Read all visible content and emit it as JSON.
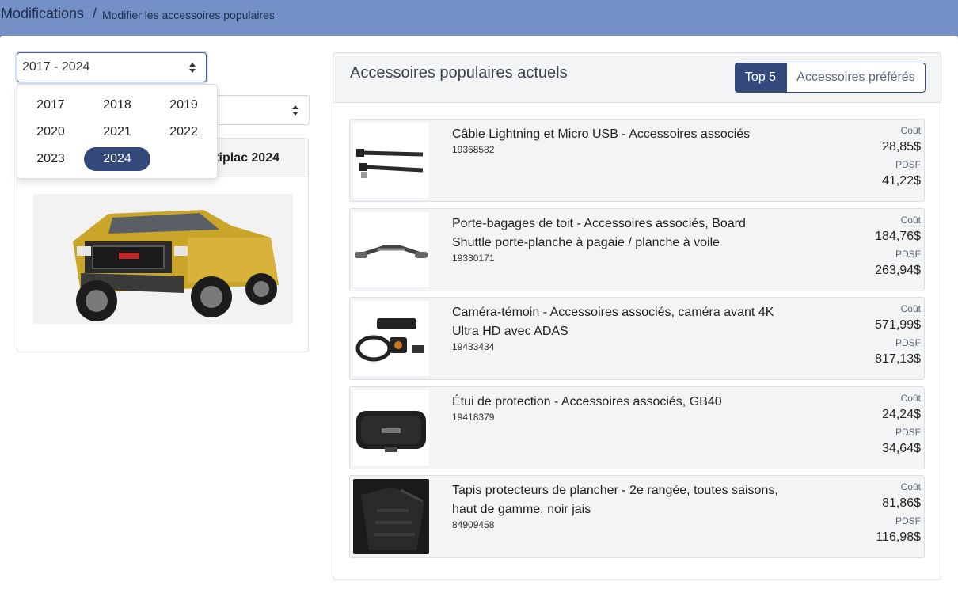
{
  "breadcrumb": {
    "main": "Modifications",
    "separator": "/",
    "sub": "Modifier les accessoires populaires"
  },
  "year_filter": {
    "value": "2017 - 2024",
    "options": [
      "2017",
      "2018",
      "2019",
      "2020",
      "2021",
      "2022",
      "2023",
      "2024"
    ],
    "selected": "2024"
  },
  "vehicle": {
    "title_visible": "tiplac 2024",
    "image": "truck-image"
  },
  "panel": {
    "title": "Accessoires populaires actuels",
    "tabs": {
      "top5": "Top 5",
      "favorites": "Accessoires préférés"
    },
    "active_tab": "Top 5"
  },
  "labels": {
    "cost": "Coût",
    "msrp": "PDSF"
  },
  "items": [
    {
      "name": "Câble Lightning et Micro USB - Accessoires associés",
      "sku": "19368582",
      "cost": "28,85$",
      "msrp": "41,22$",
      "icon": "cable-icon"
    },
    {
      "name": "Porte-bagages de toit - Accessoires associés, Board Shuttle porte-planche à pagaie / planche à voile",
      "sku": "19330171",
      "cost": "184,76$",
      "msrp": "263,94$",
      "icon": "roof-rack-icon"
    },
    {
      "name": "Caméra-témoin - Accessoires associés, caméra avant 4K Ultra HD avec ADAS",
      "sku": "19433434",
      "cost": "571,99$",
      "msrp": "817,13$",
      "icon": "dash-camera-icon"
    },
    {
      "name": "Étui de protection - Accessoires associés, GB40",
      "sku": "19418379",
      "cost": "24,24$",
      "msrp": "34,64$",
      "icon": "protective-case-icon"
    },
    {
      "name": "Tapis protecteurs de plancher - 2e rangée, toutes saisons, haut de gamme, noir jais",
      "sku": "84909458",
      "cost": "81,86$",
      "msrp": "116,98$",
      "icon": "floor-mat-icon"
    }
  ],
  "colors": {
    "header": "#7590c7",
    "primary": "#34497b",
    "panel_bg": "#f3f4f6"
  }
}
